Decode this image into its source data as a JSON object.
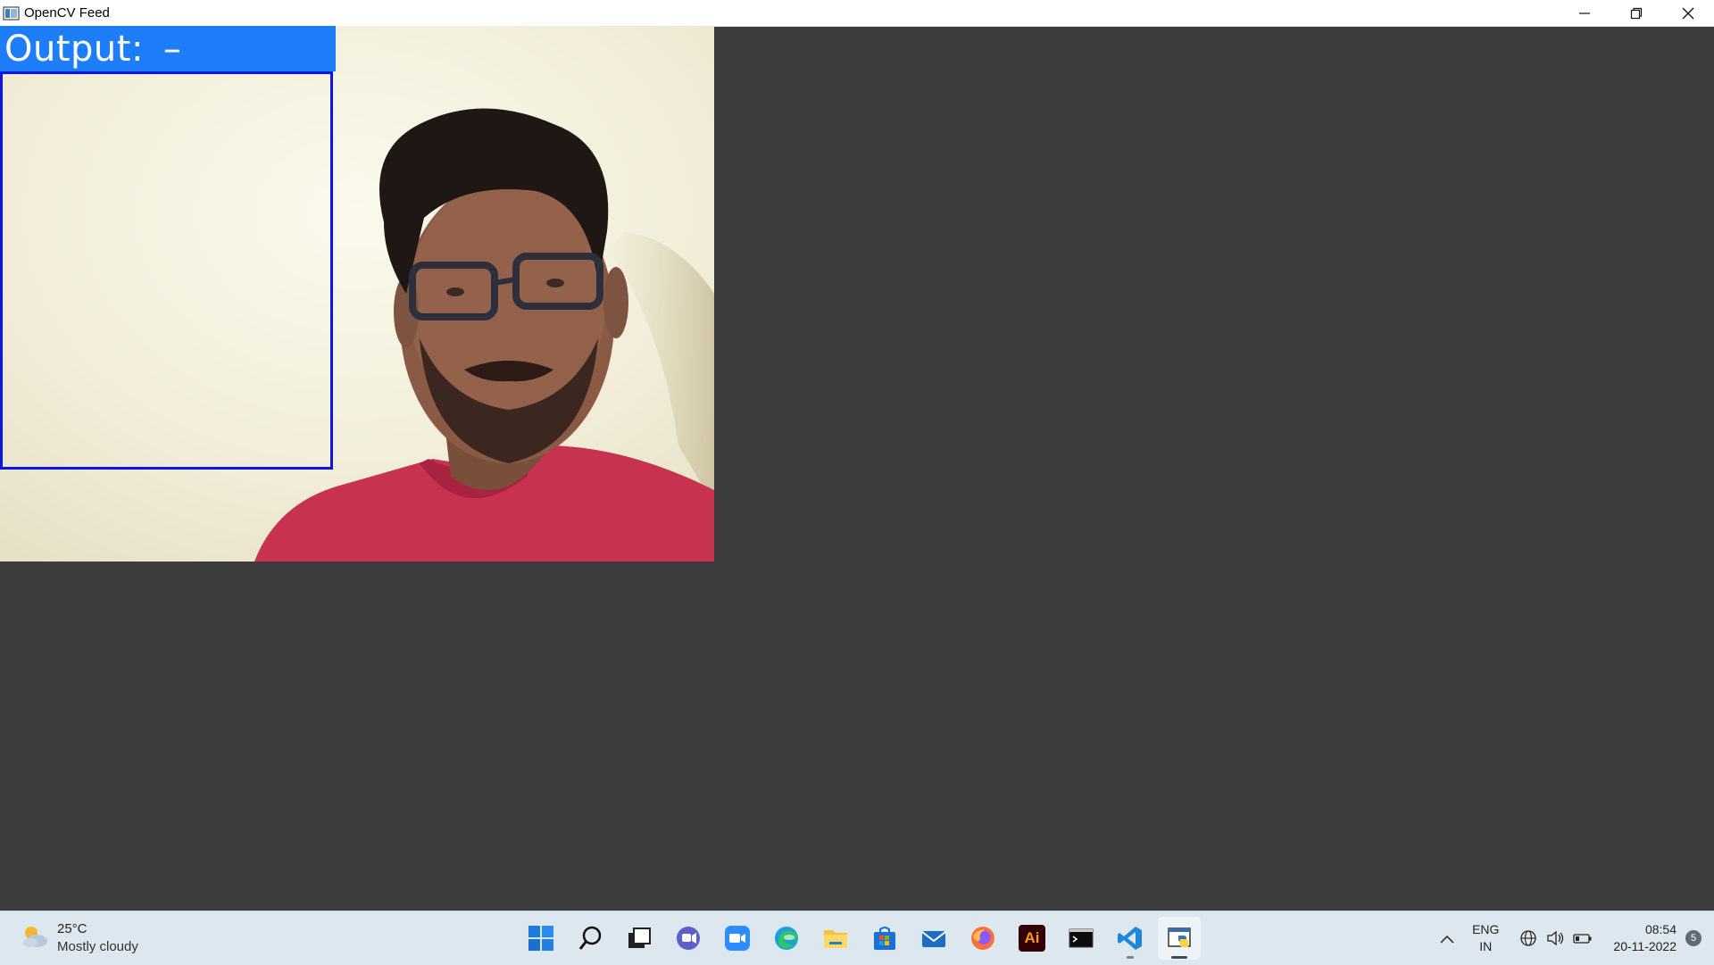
{
  "window": {
    "title": "OpenCV Feed",
    "controls": [
      "minimize",
      "restore",
      "close"
    ]
  },
  "feed": {
    "output_label": "Output:",
    "output_value": "–",
    "banner_color": "#1e7ef9",
    "roi_box_color": "#0b15e8"
  },
  "taskbar": {
    "weather": {
      "temperature": "25°C",
      "condition": "Mostly cloudy",
      "icon": "partly-cloudy-icon"
    },
    "apps": [
      {
        "name": "start-icon"
      },
      {
        "name": "search-icon"
      },
      {
        "name": "task-view-icon"
      },
      {
        "name": "teams-chat-icon"
      },
      {
        "name": "zoom-icon"
      },
      {
        "name": "edge-icon"
      },
      {
        "name": "file-explorer-icon"
      },
      {
        "name": "microsoft-store-icon"
      },
      {
        "name": "mail-icon"
      },
      {
        "name": "firefox-icon"
      },
      {
        "name": "illustrator-icon",
        "label": "Ai"
      },
      {
        "name": "terminal-icon"
      },
      {
        "name": "vscode-icon"
      },
      {
        "name": "python-icon"
      }
    ],
    "language": {
      "line1": "ENG",
      "line2": "IN"
    },
    "clock": {
      "time": "08:54",
      "date": "20-11-2022"
    },
    "notifications": "5"
  }
}
